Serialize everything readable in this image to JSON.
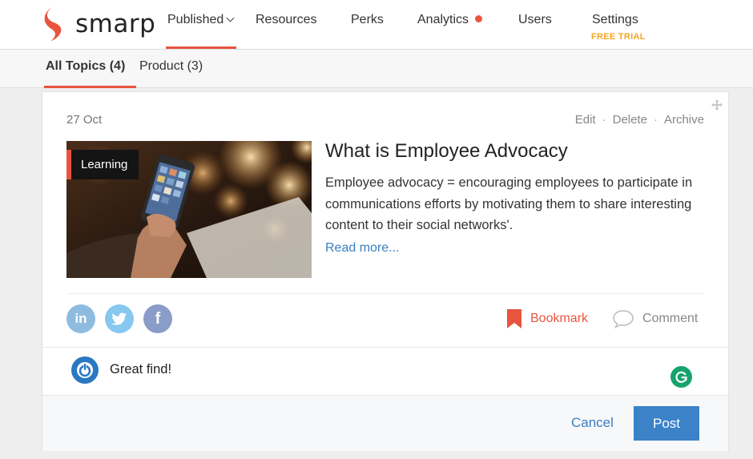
{
  "brand": {
    "name": "smarp",
    "accent": "#e8553e"
  },
  "nav": {
    "items": [
      {
        "label": "Published"
      },
      {
        "label": "Resources"
      },
      {
        "label": "Perks"
      },
      {
        "label": "Analytics"
      },
      {
        "label": "Users"
      },
      {
        "label": "Settings"
      }
    ],
    "settings_badge": "FREE TRIAL"
  },
  "subnav": {
    "tabs": [
      {
        "label": "All Topics (4)",
        "active": true
      },
      {
        "label": "Product (3)",
        "active": false
      }
    ]
  },
  "post": {
    "date": "27 Oct",
    "actions": {
      "edit": "Edit",
      "delete": "Delete",
      "archive": "Archive",
      "separator": "·"
    },
    "tag": "Learning",
    "title": "What is Employee Advocacy",
    "description": "Employee advocacy = encouraging employees to participate in communications efforts by motivating them to share interesting content to their social networks'.",
    "read_more": "Read more..."
  },
  "share": {
    "linkedin_glyph": "in",
    "facebook_glyph": "f",
    "bookmark_label": "Bookmark",
    "comment_label": "Comment"
  },
  "comment_box": {
    "value": "Great find!"
  },
  "footer": {
    "cancel_label": "Cancel",
    "post_label": "Post"
  },
  "icons": {
    "logo": "smarp-logo-icon",
    "move": "move-icon",
    "bookmark": "bookmark-icon",
    "comment": "speech-bubble-icon",
    "avatar": "power-icon",
    "grammarly": "grammarly-icon"
  },
  "colors": {
    "accent": "#e8553e",
    "link": "#3a7fbf",
    "post_button": "#3b82c9",
    "free_trial": "#f5a623",
    "linkedin": "#8dbcdf",
    "twitter": "#86c8ef",
    "facebook": "#8a9cc8"
  }
}
